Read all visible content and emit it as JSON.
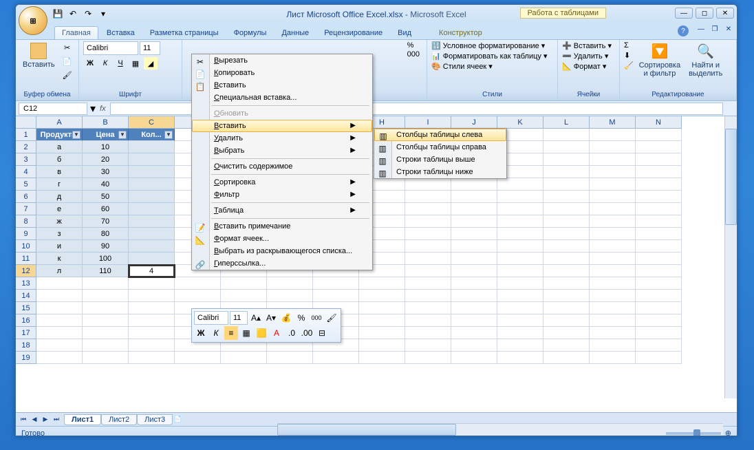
{
  "title": {
    "doc": "Лист Microsoft Office Excel.xlsx",
    "app": "Microsoft Excel"
  },
  "contextual_label": "Работа с таблицами",
  "qat": {
    "save": "💾",
    "undo": "↶",
    "redo": "↷"
  },
  "tabs": [
    "Главная",
    "Вставка",
    "Разметка страницы",
    "Формулы",
    "Данные",
    "Рецензирование",
    "Вид",
    "Конструктор"
  ],
  "ribbon": {
    "clipboard": {
      "title": "Буфер обмена",
      "paste": "Вставить"
    },
    "font": {
      "title": "Шрифт",
      "name": "Calibri",
      "size": "11",
      "bold": "Ж",
      "italic": "К",
      "underline": "Ч"
    },
    "styles": {
      "title": "Стили",
      "cond": "Условное форматирование",
      "fmt_table": "Форматировать как таблицу",
      "cell_styles": "Стили ячеек"
    },
    "cells": {
      "title": "Ячейки",
      "insert": "Вставить",
      "delete": "Удалить",
      "format": "Формат"
    },
    "editing": {
      "title": "Редактирование",
      "sigma": "Σ",
      "sort": "Сортировка\nи фильтр",
      "find": "Найти и\nвыделить"
    },
    "number_fmt": {
      "percent": "%",
      "comma": "000"
    }
  },
  "name_box": "C12",
  "fx": "fx",
  "columns": [
    "A",
    "B",
    "C",
    "D",
    "E",
    "F",
    "G",
    "H",
    "I",
    "J",
    "K",
    "L",
    "M",
    "N"
  ],
  "rows": [
    "1",
    "2",
    "3",
    "4",
    "5",
    "6",
    "7",
    "8",
    "9",
    "10",
    "11",
    "12",
    "13",
    "14",
    "15",
    "16",
    "17",
    "18",
    "19"
  ],
  "table": {
    "headers": [
      "Продукты",
      "Цена",
      "Кол..."
    ],
    "data": [
      [
        "а",
        "10",
        ""
      ],
      [
        "б",
        "20",
        ""
      ],
      [
        "в",
        "30",
        ""
      ],
      [
        "г",
        "40",
        ""
      ],
      [
        "д",
        "50",
        ""
      ],
      [
        "е",
        "60",
        ""
      ],
      [
        "ж",
        "70",
        ""
      ],
      [
        "з",
        "80",
        ""
      ],
      [
        "и",
        "90",
        ""
      ],
      [
        "к",
        "100",
        ""
      ],
      [
        "л",
        "110",
        "4"
      ]
    ]
  },
  "context_menu": {
    "items": [
      {
        "icon": "✂",
        "label": "Вырезать"
      },
      {
        "icon": "📄",
        "label": "Копировать"
      },
      {
        "icon": "📋",
        "label": "Вставить"
      },
      {
        "label": "Специальная вставка..."
      },
      {
        "sep": true
      },
      {
        "label": "Обновить",
        "disabled": true
      },
      {
        "label": "Вставить",
        "arrow": true,
        "hover": true
      },
      {
        "label": "Удалить",
        "arrow": true
      },
      {
        "label": "Выбрать",
        "arrow": true
      },
      {
        "sep": true
      },
      {
        "label": "Очистить содержимое"
      },
      {
        "sep": true
      },
      {
        "label": "Сортировка",
        "arrow": true
      },
      {
        "label": "Фильтр",
        "arrow": true
      },
      {
        "sep": true
      },
      {
        "label": "Таблица",
        "arrow": true
      },
      {
        "sep": true
      },
      {
        "icon": "📝",
        "label": "Вставить примечание"
      },
      {
        "icon": "📐",
        "label": "Формат ячеек..."
      },
      {
        "label": "Выбрать из раскрывающегося списка..."
      },
      {
        "icon": "🔗",
        "label": "Гиперссылка..."
      }
    ]
  },
  "submenu": [
    {
      "label": "Столбцы таблицы слева",
      "hover": true
    },
    {
      "label": "Столбцы таблицы справа"
    },
    {
      "label": "Строки таблицы выше"
    },
    {
      "label": "Строки таблицы ниже"
    }
  ],
  "mini_toolbar": {
    "font": "Calibri",
    "size": "11",
    "percent": "%",
    "comma": "000"
  },
  "sheet_tabs": [
    "Лист1",
    "Лист2",
    "Лист3"
  ],
  "status": {
    "ready": "Готово",
    "zoom": "100%"
  }
}
